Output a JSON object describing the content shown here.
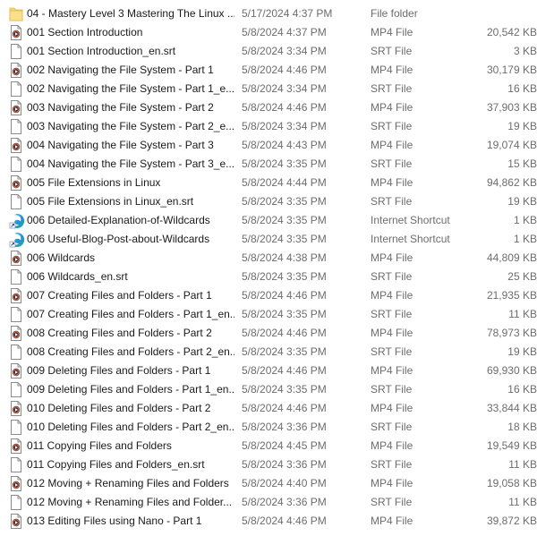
{
  "file_list": {
    "rows": [
      {
        "name": "04 - Mastery Level 3 Mastering The Linux ...",
        "date": "5/17/2024 4:37 PM",
        "type": "File folder",
        "size": "",
        "icon": "folder-icon"
      },
      {
        "name": "001 Section Introduction",
        "date": "5/8/2024 4:37 PM",
        "type": "MP4 File",
        "size": "20,542 KB",
        "icon": "video-file-icon"
      },
      {
        "name": "001 Section Introduction_en.srt",
        "date": "5/8/2024 3:34 PM",
        "type": "SRT File",
        "size": "3 KB",
        "icon": "blank-file-icon"
      },
      {
        "name": "002 Navigating the File System - Part 1",
        "date": "5/8/2024 4:46 PM",
        "type": "MP4 File",
        "size": "30,179 KB",
        "icon": "video-file-icon"
      },
      {
        "name": "002 Navigating the File System - Part 1_e...",
        "date": "5/8/2024 3:34 PM",
        "type": "SRT File",
        "size": "16 KB",
        "icon": "blank-file-icon"
      },
      {
        "name": "003 Navigating the File System - Part 2",
        "date": "5/8/2024 4:46 PM",
        "type": "MP4 File",
        "size": "37,903 KB",
        "icon": "video-file-icon"
      },
      {
        "name": "003 Navigating the File System - Part 2_e...",
        "date": "5/8/2024 3:34 PM",
        "type": "SRT File",
        "size": "19 KB",
        "icon": "blank-file-icon"
      },
      {
        "name": "004 Navigating the File System - Part 3",
        "date": "5/8/2024 4:43 PM",
        "type": "MP4 File",
        "size": "19,074 KB",
        "icon": "video-file-icon"
      },
      {
        "name": "004 Navigating the File System - Part 3_e...",
        "date": "5/8/2024 3:35 PM",
        "type": "SRT File",
        "size": "15 KB",
        "icon": "blank-file-icon"
      },
      {
        "name": "005 File Extensions in Linux",
        "date": "5/8/2024 4:44 PM",
        "type": "MP4 File",
        "size": "94,862 KB",
        "icon": "video-file-icon"
      },
      {
        "name": "005 File Extensions in Linux_en.srt",
        "date": "5/8/2024 3:35 PM",
        "type": "SRT File",
        "size": "19 KB",
        "icon": "blank-file-icon"
      },
      {
        "name": "006 Detailed-Explanation-of-Wildcards",
        "date": "5/8/2024 3:35 PM",
        "type": "Internet Shortcut",
        "size": "1 KB",
        "icon": "edge-shortcut-icon"
      },
      {
        "name": "006 Useful-Blog-Post-about-Wildcards",
        "date": "5/8/2024 3:35 PM",
        "type": "Internet Shortcut",
        "size": "1 KB",
        "icon": "edge-shortcut-icon"
      },
      {
        "name": "006 Wildcards",
        "date": "5/8/2024 4:38 PM",
        "type": "MP4 File",
        "size": "44,809 KB",
        "icon": "video-file-icon"
      },
      {
        "name": "006 Wildcards_en.srt",
        "date": "5/8/2024 3:35 PM",
        "type": "SRT File",
        "size": "25 KB",
        "icon": "blank-file-icon"
      },
      {
        "name": "007 Creating Files and Folders - Part 1",
        "date": "5/8/2024 4:46 PM",
        "type": "MP4 File",
        "size": "21,935 KB",
        "icon": "video-file-icon"
      },
      {
        "name": "007 Creating Files and Folders - Part 1_en...",
        "date": "5/8/2024 3:35 PM",
        "type": "SRT File",
        "size": "11 KB",
        "icon": "blank-file-icon"
      },
      {
        "name": "008 Creating Files and Folders - Part 2",
        "date": "5/8/2024 4:46 PM",
        "type": "MP4 File",
        "size": "78,973 KB",
        "icon": "video-file-icon"
      },
      {
        "name": "008 Creating Files and Folders - Part 2_en...",
        "date": "5/8/2024 3:35 PM",
        "type": "SRT File",
        "size": "19 KB",
        "icon": "blank-file-icon"
      },
      {
        "name": "009 Deleting Files and Folders - Part 1",
        "date": "5/8/2024 4:46 PM",
        "type": "MP4 File",
        "size": "69,930 KB",
        "icon": "video-file-icon"
      },
      {
        "name": "009 Deleting Files and Folders - Part 1_en....",
        "date": "5/8/2024 3:35 PM",
        "type": "SRT File",
        "size": "16 KB",
        "icon": "blank-file-icon"
      },
      {
        "name": "010 Deleting Files and Folders - Part 2",
        "date": "5/8/2024 4:46 PM",
        "type": "MP4 File",
        "size": "33,844 KB",
        "icon": "video-file-icon"
      },
      {
        "name": "010 Deleting Files and Folders - Part 2_en....",
        "date": "5/8/2024 3:36 PM",
        "type": "SRT File",
        "size": "18 KB",
        "icon": "blank-file-icon"
      },
      {
        "name": "011 Copying Files and Folders",
        "date": "5/8/2024 4:45 PM",
        "type": "MP4 File",
        "size": "19,549 KB",
        "icon": "video-file-icon"
      },
      {
        "name": "011 Copying Files and Folders_en.srt",
        "date": "5/8/2024 3:36 PM",
        "type": "SRT File",
        "size": "11 KB",
        "icon": "blank-file-icon"
      },
      {
        "name": "012 Moving + Renaming Files and Folders",
        "date": "5/8/2024 4:40 PM",
        "type": "MP4 File",
        "size": "19,058 KB",
        "icon": "video-file-icon"
      },
      {
        "name": "012 Moving + Renaming Files and Folder...",
        "date": "5/8/2024 3:36 PM",
        "type": "SRT File",
        "size": "11 KB",
        "icon": "blank-file-icon"
      },
      {
        "name": "013 Editing Files using Nano - Part 1",
        "date": "5/8/2024 4:46 PM",
        "type": "MP4 File",
        "size": "39,872 KB",
        "icon": "video-file-icon"
      }
    ]
  }
}
